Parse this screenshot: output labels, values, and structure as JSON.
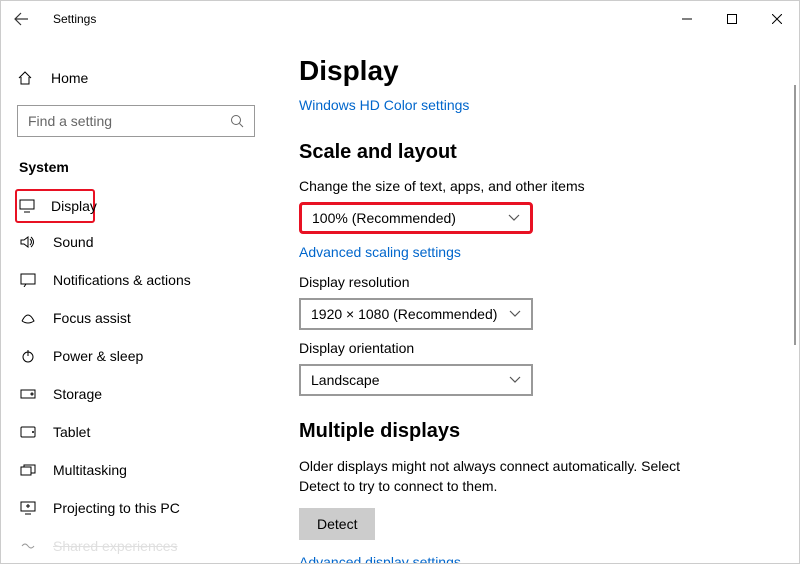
{
  "titlebar": {
    "title": "Settings"
  },
  "sidebar": {
    "home": "Home",
    "search_placeholder": "Find a setting",
    "category": "System",
    "items": [
      {
        "label": "Display"
      },
      {
        "label": "Sound"
      },
      {
        "label": "Notifications & actions"
      },
      {
        "label": "Focus assist"
      },
      {
        "label": "Power & sleep"
      },
      {
        "label": "Storage"
      },
      {
        "label": "Tablet"
      },
      {
        "label": "Multitasking"
      },
      {
        "label": "Projecting to this PC"
      },
      {
        "label": "Shared experiences"
      }
    ]
  },
  "content": {
    "page_title": "Display",
    "hd_link": "Windows HD Color settings",
    "scale": {
      "heading": "Scale and layout",
      "size_label": "Change the size of text, apps, and other items",
      "size_value": "100% (Recommended)",
      "advanced_link": "Advanced scaling settings",
      "resolution_label": "Display resolution",
      "resolution_value": "1920 × 1080 (Recommended)",
      "orientation_label": "Display orientation",
      "orientation_value": "Landscape"
    },
    "multiple": {
      "heading": "Multiple displays",
      "text": "Older displays might not always connect automatically. Select Detect to try to connect to them.",
      "detect_label": "Detect",
      "advanced_link": "Advanced display settings"
    }
  }
}
